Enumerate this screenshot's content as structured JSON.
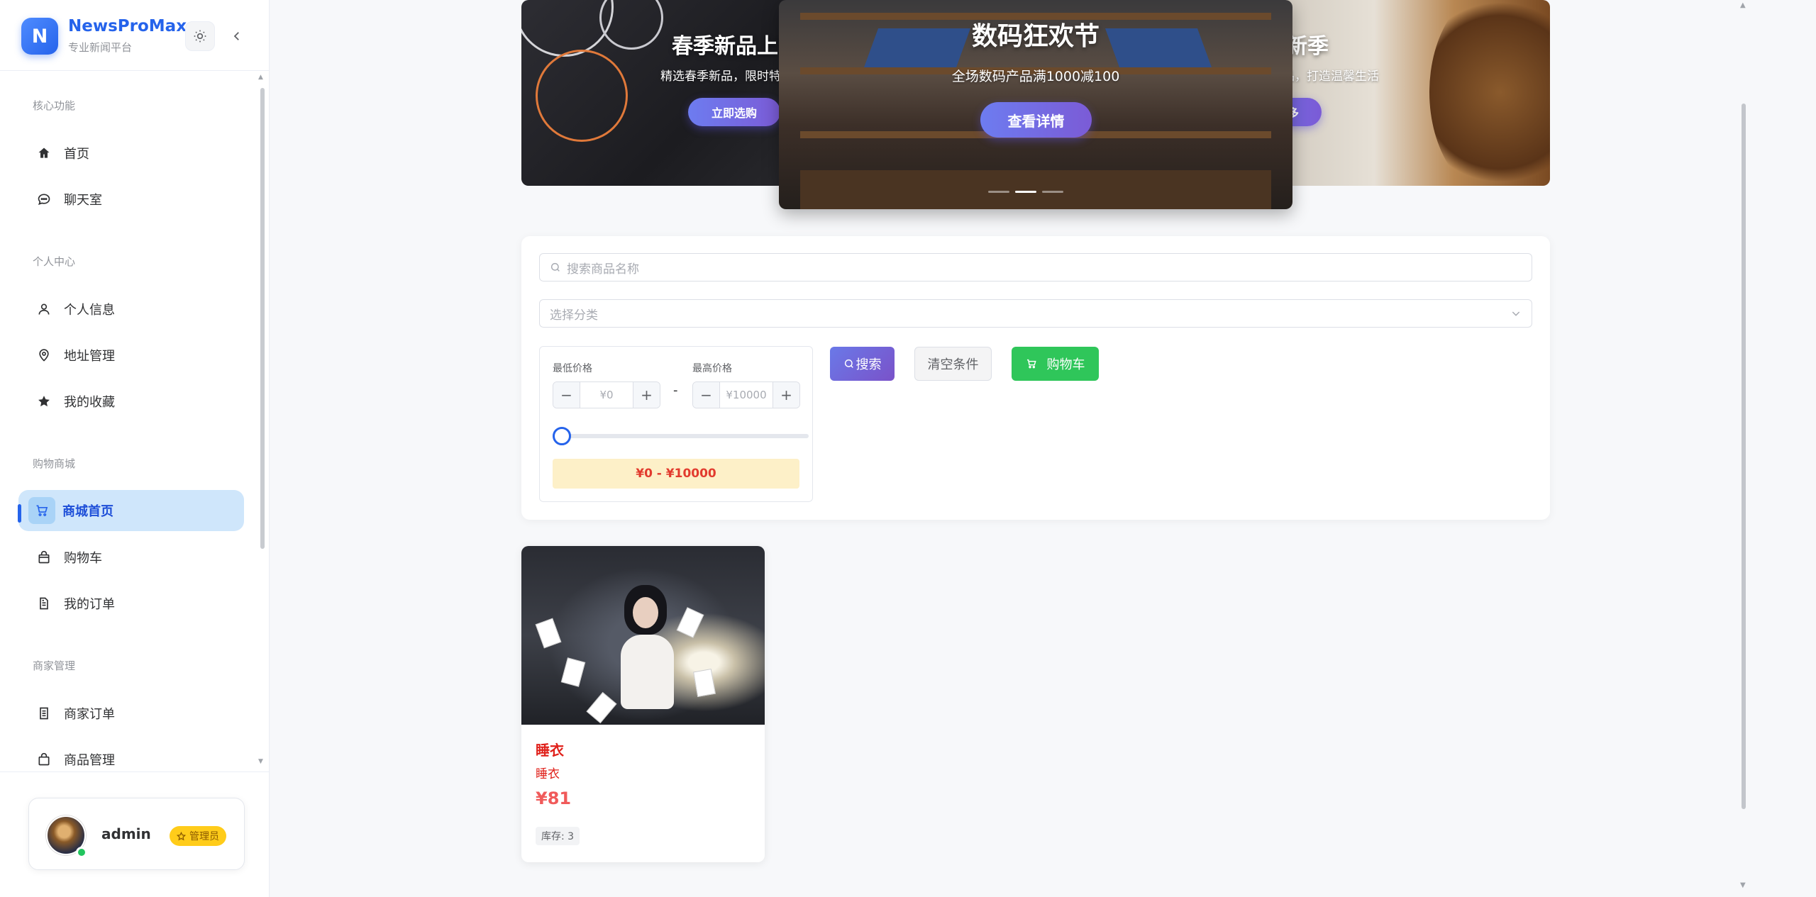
{
  "app": {
    "logo_letter": "N",
    "name": "NewsProMax",
    "subtitle": "专业新闻平台"
  },
  "sidebar": {
    "groups": [
      {
        "title": "核心功能",
        "items": [
          {
            "label": "首页",
            "icon": "home-icon"
          },
          {
            "label": "聊天室",
            "icon": "chat-icon"
          }
        ]
      },
      {
        "title": "个人中心",
        "items": [
          {
            "label": "个人信息",
            "icon": "user-icon"
          },
          {
            "label": "地址管理",
            "icon": "location-icon"
          },
          {
            "label": "我的收藏",
            "icon": "star-icon"
          }
        ]
      },
      {
        "title": "购物商城",
        "items": [
          {
            "label": "商城首页",
            "icon": "cart-icon",
            "active": true
          },
          {
            "label": "购物车",
            "icon": "bag-icon"
          },
          {
            "label": "我的订单",
            "icon": "document-icon"
          }
        ]
      },
      {
        "title": "商家管理",
        "items": [
          {
            "label": "商家订单",
            "icon": "document-icon"
          },
          {
            "label": "商品管理",
            "icon": "bag-icon"
          }
        ]
      }
    ]
  },
  "user": {
    "name": "admin",
    "role": "管理员",
    "online": true
  },
  "carousel": {
    "slides": [
      {
        "title": "春季新品上市",
        "desc": "精选春季新品，限时特惠",
        "button": "立即选购"
      },
      {
        "title": "数码狂欢节",
        "desc": "全场数码产品满1000减100",
        "button": "查看详情"
      },
      {
        "title": "家居焕新季",
        "desc": "精选家居用品，打造温馨生活",
        "button": "探索更多"
      }
    ],
    "active_index": 1
  },
  "filters": {
    "search_placeholder": "搜索商品名称",
    "category_placeholder": "选择分类",
    "min_label": "最低价格",
    "max_label": "最高价格",
    "min_placeholder": "¥0",
    "max_placeholder": "¥10000",
    "range_text": "¥0 - ¥10000",
    "slider_value": 0,
    "buttons": {
      "search": "搜索",
      "clear": "清空条件",
      "cart": "购物车"
    }
  },
  "products": [
    {
      "name": "睡衣",
      "desc": "睡衣",
      "price": "¥81",
      "stock": "库存: 3"
    }
  ],
  "colors": {
    "primary": "#2563eb",
    "accent_purple": "#7a52c9",
    "success": "#2fc65a",
    "price_red": "#e0201a",
    "badge_yellow": "#ffcc1a"
  }
}
